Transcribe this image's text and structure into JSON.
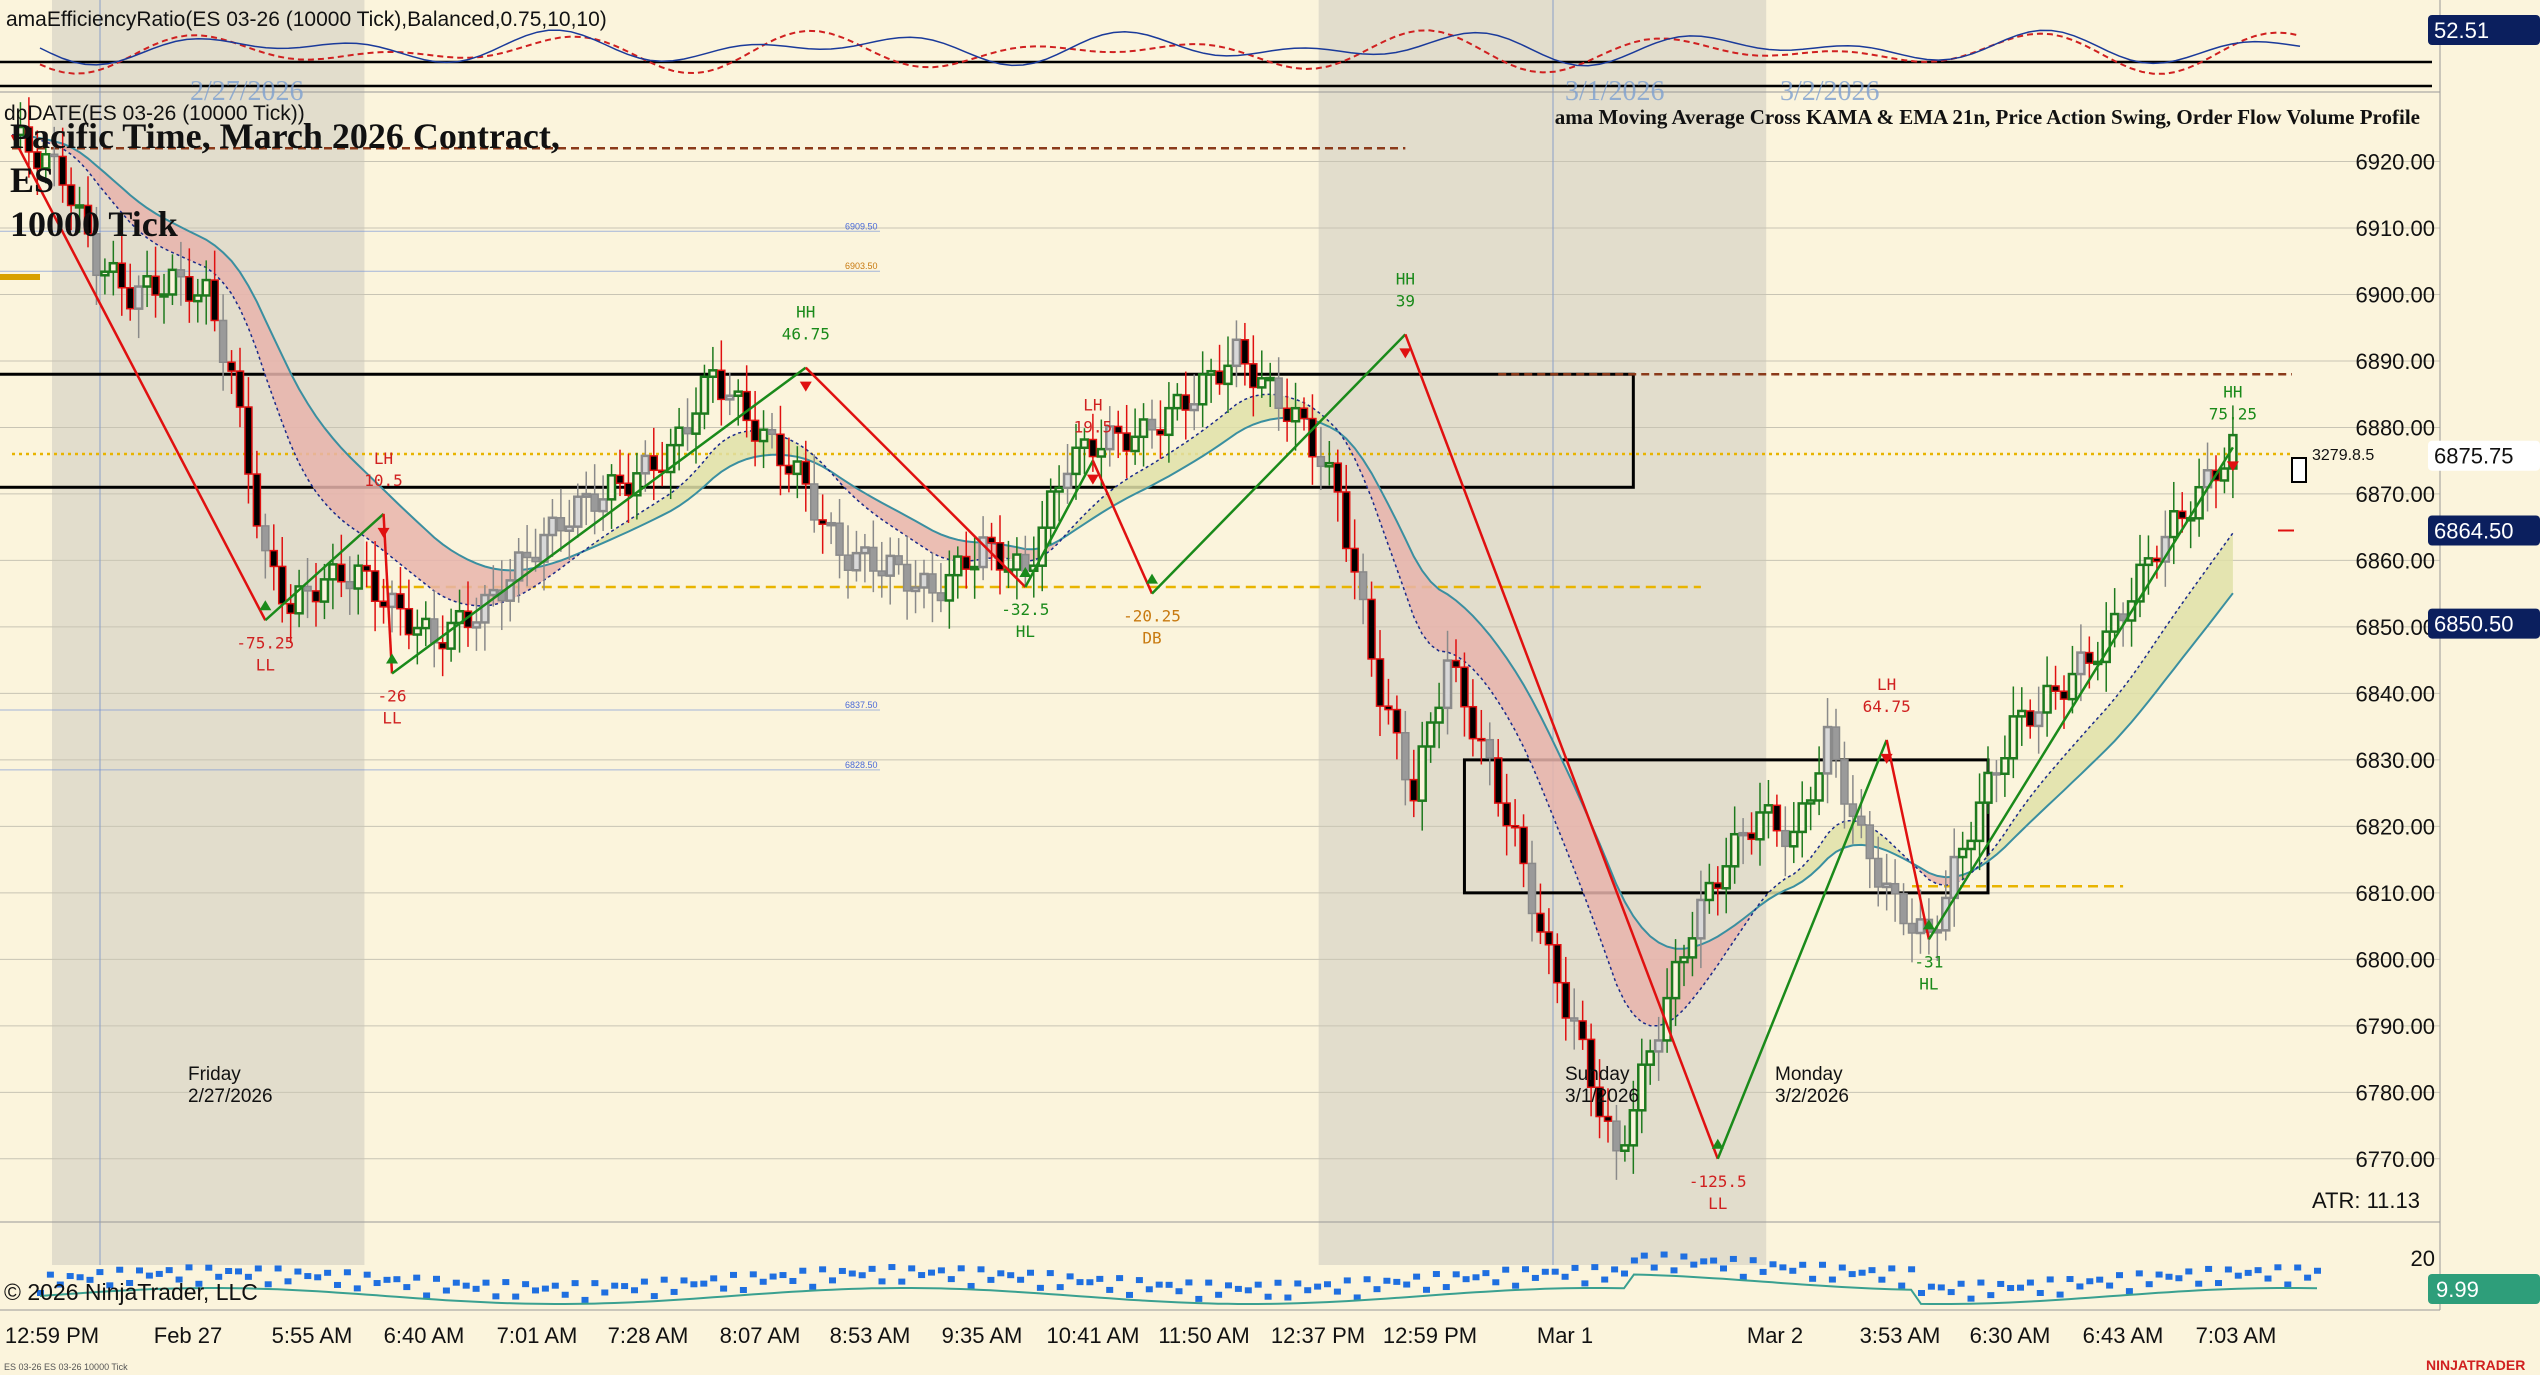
{
  "indicator_title": "amaEfficiencyRatio(ES 03-26 (10000 Tick),Balanced,0.75,10,10)",
  "indicator_value": "52.51",
  "price_panel_title": "dpDATE(ES 03-26 (10000 Tick))",
  "chart_heading": [
    "Pacific Time, March 2026 Contract,",
    "ES",
    "10000 Tick"
  ],
  "indicator_list": "ama Moving Average Cross KAMA & EMA 21n, Price Action Swing, Order Flow Volume Profile",
  "copyright": "© 2026 NinjaTrader, LLC",
  "atr_label": "ATR: 11.13",
  "volume_value": "9.99",
  "volume_axis_label": "20",
  "brand": "NINJATRADER",
  "footer_note": "ES 03-26 ES 03-26 10000 Tick",
  "price_markers": {
    "last": "6875.75",
    "marker_dark_1": "6864.50",
    "marker_dark_2": "6850.50"
  },
  "cursor_readout": "3279.8.5",
  "session_labels": [
    {
      "day": "Friday",
      "date": "2/27/2026"
    },
    {
      "day": "Sunday",
      "date": "3/1/2026"
    },
    {
      "day": "Monday",
      "date": "3/2/2026"
    }
  ],
  "faded_date_labels": [
    "2/27/2026",
    "3/1/2026",
    "3/2/2026"
  ],
  "profile_levels": [
    "6909.50",
    "6903.50",
    "6837.50",
    "6828.50"
  ],
  "swing_labels": [
    {
      "value": "-75.25",
      "type": "LL"
    },
    {
      "value": "-26",
      "type": "LL"
    },
    {
      "value": "46.75",
      "type": "HH"
    },
    {
      "value": "19.5",
      "type": "LH"
    },
    {
      "value": "-32.5",
      "type": "HL"
    },
    {
      "value": "-20.25",
      "type": "DB"
    },
    {
      "value": "39",
      "type": "HH"
    },
    {
      "value": "10.5",
      "type": "LH"
    },
    {
      "value": "-125.5",
      "type": "LL"
    },
    {
      "value": "64.75",
      "type": "LH"
    },
    {
      "value": "-31",
      "type": "HL"
    },
    {
      "value": "75.25",
      "type": "HH"
    }
  ],
  "colors": {
    "background": "#fbf4dc",
    "session_shade": "#e2ddcc",
    "up_candle": "#1e7a1e",
    "down_candle": "#000000",
    "swing_down": "#e01010",
    "swing_up": "#1a8a1a",
    "kama_line": "#3a8fa0",
    "cloud_bear": "#e8b4ac",
    "cloud_bull": "#dfe0a8",
    "gold_level": "#e8b400",
    "resistance_dash": "#8b3a1a",
    "volume_dots": "#1f6fe0",
    "axis_marker_dark": "#0b1f5e"
  },
  "chart_data": {
    "type": "candlestick",
    "title": "Pacific Time, March 2026 Contract, ES 10000 Tick",
    "y_axis": {
      "min": 6762,
      "max": 6930,
      "ticks": [
        6920,
        6910,
        6900,
        6890,
        6880,
        6870,
        6860,
        6850,
        6840,
        6830,
        6820,
        6810,
        6800,
        6790,
        6780,
        6770
      ]
    },
    "x_tick_labels": [
      "12:59 PM",
      "Feb 27",
      "5:55 AM",
      "6:40 AM",
      "7:01 AM",
      "7:28 AM",
      "8:07 AM",
      "8:53 AM",
      "9:35 AM",
      "10:41 AM",
      "11:50 AM",
      "12:37 PM",
      "12:59 PM",
      "Mar 1",
      "Mar 2",
      "3:53 AM",
      "6:30 AM",
      "6:43 AM",
      "7:03 AM"
    ],
    "price_path": [
      [
        0,
        6924
      ],
      [
        6,
        6918
      ],
      [
        10,
        6905
      ],
      [
        14,
        6900
      ],
      [
        19,
        6902
      ],
      [
        23,
        6900
      ],
      [
        26,
        6888
      ],
      [
        30,
        6860
      ],
      [
        33,
        6853
      ],
      [
        37,
        6857
      ],
      [
        41,
        6858
      ],
      [
        45,
        6853
      ],
      [
        50,
        6848
      ],
      [
        56,
        6853
      ],
      [
        62,
        6862
      ],
      [
        67,
        6868
      ],
      [
        73,
        6872
      ],
      [
        78,
        6876
      ],
      [
        83,
        6888
      ],
      [
        88,
        6880
      ],
      [
        93,
        6873
      ],
      [
        98,
        6861
      ],
      [
        104,
        6859
      ],
      [
        109,
        6855
      ],
      [
        115,
        6862
      ],
      [
        120,
        6858
      ],
      [
        125,
        6875
      ],
      [
        129,
        6878
      ],
      [
        134,
        6879
      ],
      [
        140,
        6885
      ],
      [
        145,
        6891
      ],
      [
        150,
        6884
      ],
      [
        153,
        6880
      ],
      [
        157,
        6870
      ],
      [
        162,
        6840
      ],
      [
        166,
        6825
      ],
      [
        170,
        6845
      ],
      [
        174,
        6832
      ],
      [
        178,
        6818
      ],
      [
        182,
        6800
      ],
      [
        185,
        6790
      ],
      [
        190,
        6770
      ],
      [
        195,
        6790
      ],
      [
        199,
        6805
      ],
      [
        203,
        6815
      ],
      [
        207,
        6822
      ],
      [
        211,
        6818
      ],
      [
        215,
        6833
      ],
      [
        219,
        6818
      ],
      [
        223,
        6808
      ],
      [
        227,
        6803
      ],
      [
        232,
        6820
      ],
      [
        237,
        6835
      ],
      [
        242,
        6840
      ],
      [
        248,
        6848
      ],
      [
        254,
        6862
      ],
      [
        259,
        6870
      ],
      [
        263,
        6877
      ]
    ],
    "swings": [
      {
        "bar": 30,
        "price": 6851,
        "label": "-75.25",
        "type": "LL",
        "pos": "below"
      },
      {
        "bar": 45,
        "price": 6843,
        "label": "-26",
        "type": "LL",
        "pos": "below"
      },
      {
        "bar": 94,
        "price": 6889,
        "label": "46.75",
        "type": "HH",
        "pos": "above"
      },
      {
        "bar": 128,
        "price": 6875,
        "label": "19.5",
        "type": "LH",
        "pos": "above"
      },
      {
        "bar": 120,
        "price": 6856,
        "label": "-32.5",
        "type": "HL",
        "pos": "below"
      },
      {
        "bar": 135,
        "price": 6855,
        "label": "-20.25",
        "type": "DB",
        "pos": "below"
      },
      {
        "bar": 165,
        "price": 6894,
        "label": "39",
        "type": "HH",
        "pos": "above"
      },
      {
        "bar": 44,
        "price": 6867,
        "label": "10.5",
        "type": "LH",
        "pos": "above"
      },
      {
        "bar": 202,
        "price": 6770,
        "label": "-125.5",
        "type": "LL",
        "pos": "below"
      },
      {
        "bar": 222,
        "price": 6833,
        "label": "64.75",
        "type": "LH",
        "pos": "above"
      },
      {
        "bar": 227,
        "price": 6803,
        "label": "-31",
        "type": "HL",
        "pos": "below"
      },
      {
        "bar": 263,
        "price": 6877,
        "label": "75.25",
        "type": "HH",
        "pos": "above"
      }
    ],
    "zones": [
      {
        "bar_from": 0,
        "bar_to": 192,
        "price_low": 6871,
        "price_high": 6888
      },
      {
        "bar_from": 172,
        "bar_to": 234,
        "price_low": 6810,
        "price_high": 6830
      }
    ],
    "levels": [
      {
        "price": 6922,
        "style": "dashed",
        "bar_from": 0,
        "bar_to": 165
      },
      {
        "price": 6888,
        "style": "dashed",
        "bar_from": 176,
        "bar_to": 270
      },
      {
        "price": 6876,
        "style": "dotted",
        "bar_from": 0,
        "bar_to": 270
      },
      {
        "price": 6856,
        "style": "dashed-gold",
        "bar_from": 40,
        "bar_to": 200
      },
      {
        "price": 6811,
        "style": "dashed-gold",
        "bar_from": 225,
        "bar_to": 250
      }
    ],
    "grid": true
  }
}
